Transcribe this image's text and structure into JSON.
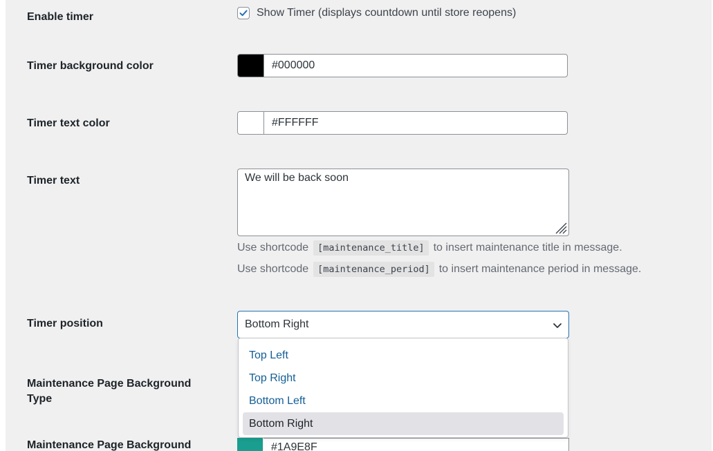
{
  "enable_timer": {
    "label": "Enable timer",
    "checkbox_label": "Show Timer (displays countdown until store reopens)",
    "checked": true,
    "check_color": "#2271b1"
  },
  "timer_bg_color": {
    "label": "Timer background color",
    "value": "#000000",
    "swatch": "#000000"
  },
  "timer_text_color": {
    "label": "Timer text color",
    "value": "#FFFFFF",
    "swatch": "#FFFFFF"
  },
  "timer_text": {
    "label": "Timer text",
    "value": "We will be back soon",
    "help1_prefix": "Use shortcode",
    "help1_code": "[maintenance_title]",
    "help1_suffix": "to insert maintenance title in message.",
    "help2_prefix": "Use shortcode",
    "help2_code": "[maintenance_period]",
    "help2_suffix": "to insert maintenance period in message."
  },
  "timer_position": {
    "label": "Timer position",
    "selected": "Bottom Right",
    "options": [
      "Top Left",
      "Top Right",
      "Bottom Left",
      "Bottom Right"
    ]
  },
  "bg_type": {
    "label_line1": "Maintenance Page Background",
    "label_line2": "Type"
  },
  "bg_next": {
    "label": "Maintenance Page Background",
    "value_partial": "#1A9E8F",
    "swatch": "#1a9e8f"
  },
  "icons": {
    "checkbox_check": "checkmark-icon",
    "select_chevron": "chevron-down-icon",
    "textarea_resize": "resize-handle-icon"
  }
}
